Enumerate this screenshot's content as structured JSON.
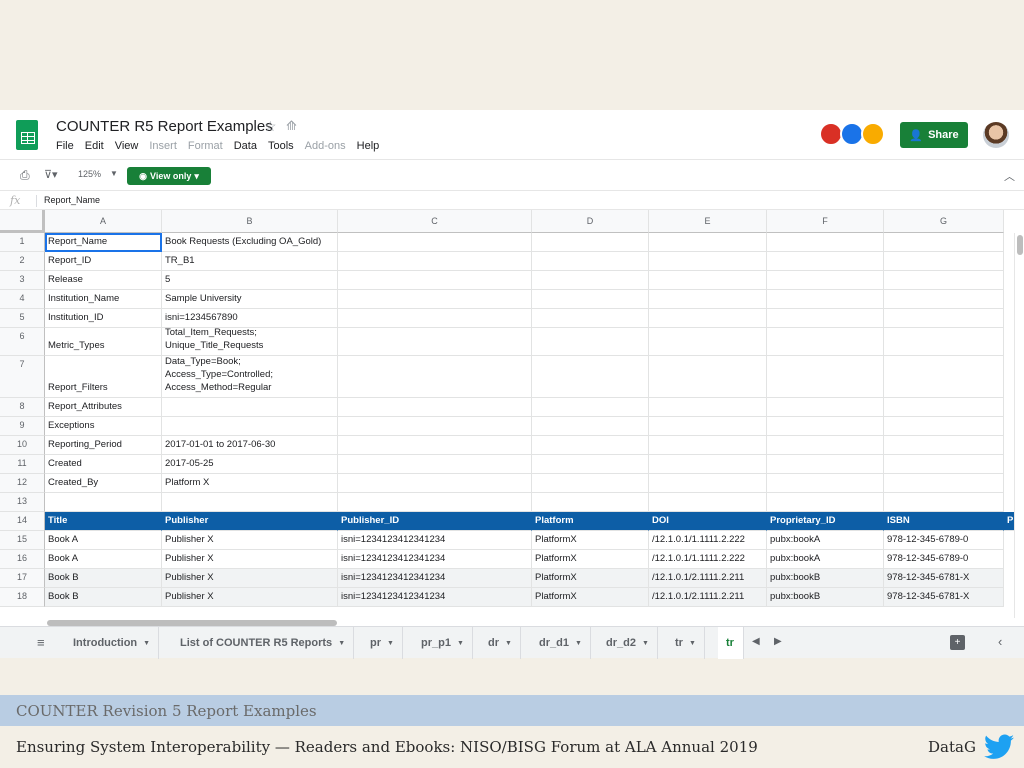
{
  "doc": {
    "title": "COUNTER R5 Report Examples",
    "menu": [
      {
        "label": "File",
        "enabled": true
      },
      {
        "label": "Edit",
        "enabled": true
      },
      {
        "label": "View",
        "enabled": true
      },
      {
        "label": "Insert",
        "enabled": false
      },
      {
        "label": "Format",
        "enabled": false
      },
      {
        "label": "Data",
        "enabled": true
      },
      {
        "label": "Tools",
        "enabled": true
      },
      {
        "label": "Add-ons",
        "enabled": false
      },
      {
        "label": "Help",
        "enabled": true
      }
    ],
    "share_label": "Share"
  },
  "toolbar": {
    "zoom": "125%",
    "view_only": "View only"
  },
  "formula": {
    "fx": "fx",
    "value": "Report_Name"
  },
  "columns": [
    "A",
    "B",
    "C",
    "D",
    "E",
    "F",
    "G"
  ],
  "rows": [
    {
      "num": "1",
      "cells": [
        "Report_Name",
        "Book Requests (Excluding OA_Gold)",
        "",
        "",
        "",
        "",
        ""
      ]
    },
    {
      "num": "2",
      "cells": [
        "Report_ID",
        "TR_B1",
        "",
        "",
        "",
        "",
        ""
      ]
    },
    {
      "num": "3",
      "cells": [
        "Release",
        "5",
        "",
        "",
        "",
        "",
        ""
      ]
    },
    {
      "num": "4",
      "cells": [
        "Institution_Name",
        "Sample University",
        "",
        "",
        "",
        "",
        ""
      ]
    },
    {
      "num": "5",
      "cells": [
        "Institution_ID",
        "isni=1234567890",
        "",
        "",
        "",
        "",
        ""
      ]
    },
    {
      "num": "6",
      "cells": [
        "Metric_Types",
        "Total_Item_Requests;\nUnique_Title_Requests",
        "",
        "",
        "",
        "",
        ""
      ]
    },
    {
      "num": "7",
      "cells": [
        "Report_Filters",
        "Data_Type=Book;\nAccess_Type=Controlled;\nAccess_Method=Regular",
        "",
        "",
        "",
        "",
        ""
      ]
    },
    {
      "num": "8",
      "cells": [
        "Report_Attributes",
        "",
        "",
        "",
        "",
        "",
        ""
      ]
    },
    {
      "num": "9",
      "cells": [
        "Exceptions",
        "",
        "",
        "",
        "",
        "",
        ""
      ]
    },
    {
      "num": "10",
      "cells": [
        "Reporting_Period",
        "2017-01-01 to 2017-06-30",
        "",
        "",
        "",
        "",
        ""
      ]
    },
    {
      "num": "11",
      "cells": [
        "Created",
        "2017-05-25",
        "",
        "",
        "",
        "",
        ""
      ]
    },
    {
      "num": "12",
      "cells": [
        "Created_By",
        "Platform X",
        "",
        "",
        "",
        "",
        ""
      ]
    },
    {
      "num": "13",
      "cells": [
        "",
        "",
        "",
        "",
        "",
        "",
        ""
      ]
    },
    {
      "num": "14",
      "cells": [
        "Title",
        "Publisher",
        "Publisher_ID",
        "Platform",
        "DOI",
        "Proprietary_ID",
        "ISBN"
      ]
    },
    {
      "num": "15",
      "cells": [
        "Book A",
        "Publisher X",
        "isni=1234123412341234",
        "PlatformX",
        "/12.1.0.1/1.1111.2.222",
        "pubx:bookA",
        "978-12-345-6789-0"
      ]
    },
    {
      "num": "16",
      "cells": [
        "Book A",
        "Publisher X",
        "isni=1234123412341234",
        "PlatformX",
        "/12.1.0.1/1.1111.2.222",
        "pubx:bookA",
        "978-12-345-6789-0"
      ]
    },
    {
      "num": "17",
      "cells": [
        "Book B",
        "Publisher X",
        "isni=1234123412341234",
        "PlatformX",
        "/12.1.0.1/2.1111.2.211",
        "pubx:bookB",
        "978-12-345-6781-X"
      ]
    },
    {
      "num": "18",
      "cells": [
        "Book B",
        "Publisher X",
        "isni=1234123412341234",
        "PlatformX",
        "/12.1.0.1/2.1111.2.211",
        "pubx:bookB",
        "978-12-345-6781-X"
      ]
    }
  ],
  "header_overflow": "P",
  "sheet_tabs": [
    "Introduction",
    "List of COUNTER R5 Reports",
    "pr",
    "pr_p1",
    "dr",
    "dr_d1",
    "dr_d2",
    "tr",
    "tr"
  ],
  "slide": {
    "title": "COUNTER Revision 5 Report Examples",
    "caption": "Ensuring System Interoperability — Readers and Ebooks: NISO/BISG Forum at ALA Annual 2019",
    "brand": "DataG"
  },
  "colors": {
    "sheets_green": "#188038",
    "header_blue": "#0d5ea6",
    "footer_band": "#b9cde3",
    "twitter_blue": "#1da1f2"
  }
}
